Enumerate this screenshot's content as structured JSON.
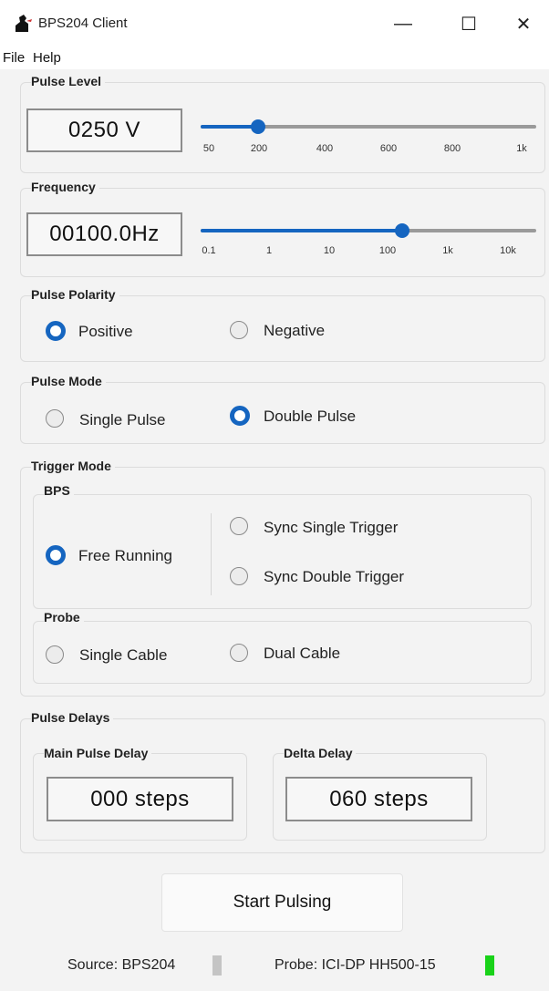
{
  "window": {
    "title": "BPS204 Client",
    "minimize_glyph": "—",
    "maximize_glyph": "☐",
    "close_glyph": "✕"
  },
  "menu": [
    "File",
    "Help"
  ],
  "pulse_level": {
    "title": "Pulse Level",
    "value": "0250 V",
    "ticks": [
      "50",
      "200",
      "400",
      "600",
      "800",
      "1k"
    ],
    "slider_position": 0.17
  },
  "frequency": {
    "title": "Frequency",
    "value": "00100.0Hz",
    "ticks": [
      "0.1",
      "1",
      "10",
      "100",
      "1k",
      "10k"
    ],
    "slider_position": 0.6
  },
  "pulse_polarity": {
    "title": "Pulse Polarity",
    "options": [
      "Positive",
      "Negative"
    ],
    "selected": "Positive"
  },
  "pulse_mode": {
    "title": "Pulse Mode",
    "options": [
      "Single Pulse",
      "Double Pulse"
    ],
    "selected": "Double Pulse"
  },
  "trigger_mode": {
    "title": "Trigger Mode",
    "bps": {
      "title": "BPS",
      "options": [
        "Free Running",
        "Sync Single Trigger",
        "Sync Double Trigger"
      ],
      "selected": "Free Running"
    },
    "probe": {
      "title": "Probe",
      "options": [
        "Single Cable",
        "Dual Cable"
      ],
      "selected": ""
    }
  },
  "pulse_delays": {
    "title": "Pulse Delays",
    "main": {
      "title": "Main Pulse Delay",
      "value": "000 steps"
    },
    "delta": {
      "title": "Delta Delay",
      "value": "060 steps"
    }
  },
  "start_button": "Start Pulsing",
  "status": {
    "source": "Source: BPS204",
    "source_color": "#c4c4c4",
    "probe": "Probe: ICI-DP HH500-15",
    "probe_color": "#19d219"
  },
  "colors": {
    "accent": "#1565c0"
  }
}
